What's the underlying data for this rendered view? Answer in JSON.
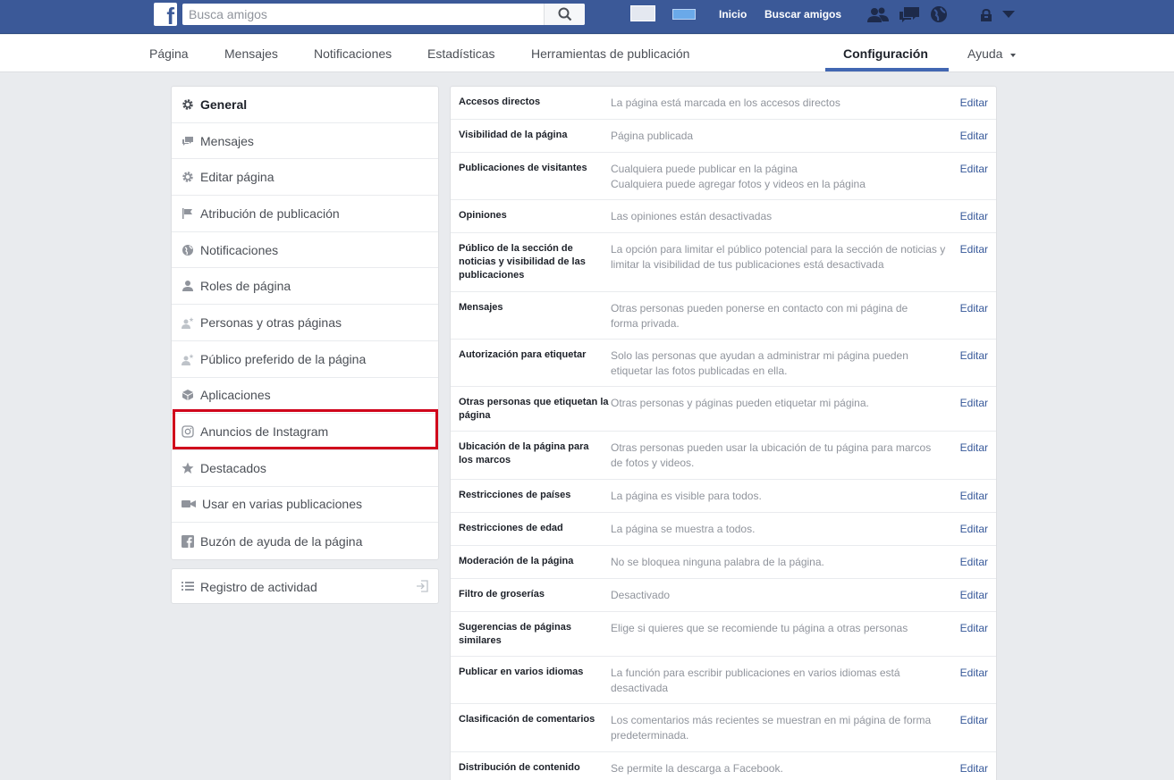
{
  "topbar": {
    "logo": "f",
    "search_placeholder": "Busca amigos",
    "home_label": "Inicio",
    "find_friends_label": "Buscar amigos",
    "icons": [
      "friend-requests-icon",
      "messages-icon",
      "notifications-globe-icon",
      "privacy-lock-icon",
      "account-menu-caret-icon"
    ]
  },
  "pagenav": {
    "items": [
      "Página",
      "Mensajes",
      "Notificaciones",
      "Estadísticas",
      "Herramientas de publicación",
      "Configuración",
      "Ayuda"
    ],
    "active": "Configuración"
  },
  "sidebar": {
    "items": [
      {
        "label": "General",
        "icon": "gear-icon"
      },
      {
        "label": "Mensajes",
        "icon": "messages-icon"
      },
      {
        "label": "Editar página",
        "icon": "gear-icon"
      },
      {
        "label": "Atribución de publicación",
        "icon": "flag-icon"
      },
      {
        "label": "Notificaciones",
        "icon": "globe-icon"
      },
      {
        "label": "Roles de página",
        "icon": "person-icon"
      },
      {
        "label": "Personas y otras páginas",
        "icon": "person-star-icon"
      },
      {
        "label": "Público preferido de la página",
        "icon": "person-star-icon"
      },
      {
        "label": "Aplicaciones",
        "icon": "cube-icon"
      },
      {
        "label": "Anuncios de Instagram",
        "icon": "instagram-icon"
      },
      {
        "label": "Destacados",
        "icon": "star-icon"
      },
      {
        "label": "Usar en varias publicaciones",
        "icon": "video-camera-icon"
      },
      {
        "label": "Buzón de ayuda de la página",
        "icon": "facebook-square-icon"
      }
    ],
    "activity_log": {
      "label": "Registro de actividad",
      "icon": "list-icon",
      "action_icon": "export-icon"
    }
  },
  "settings": {
    "edit_label": "Editar",
    "rows": [
      {
        "label": "Accesos directos",
        "value": "La página está marcada en los accesos directos"
      },
      {
        "label": "Visibilidad de la página",
        "value": "Página publicada"
      },
      {
        "label": "Publicaciones de visitantes",
        "value": "Cualquiera puede publicar en la página\nCualquiera puede agregar fotos y videos en la página"
      },
      {
        "label": "Opiniones",
        "value": "Las opiniones están desactivadas"
      },
      {
        "label": "Público de la sección de noticias y visibilidad de las publicaciones",
        "value": "La opción para limitar el público potencial para la sección de noticias y limitar la visibilidad de tus publicaciones está desactivada"
      },
      {
        "label": "Mensajes",
        "value": "Otras personas pueden ponerse en contacto con mi página de forma privada."
      },
      {
        "label": "Autorización para etiquetar",
        "value": "Solo las personas que ayudan a administrar mi página pueden etiquetar las fotos publicadas en ella."
      },
      {
        "label": "Otras personas que etiquetan la página",
        "value": "Otras personas y páginas pueden etiquetar mi página."
      },
      {
        "label": "Ubicación de la página para los marcos",
        "value": "Otras personas pueden usar la ubicación de tu página para marcos de fotos y videos."
      },
      {
        "label": "Restricciones de países",
        "value": "La página es visible para todos."
      },
      {
        "label": "Restricciones de edad",
        "value": "La página se muestra a todos."
      },
      {
        "label": "Moderación de la página",
        "value": "No se bloquea ninguna palabra de la página."
      },
      {
        "label": "Filtro de groserías",
        "value": "Desactivado"
      },
      {
        "label": "Sugerencias de páginas similares",
        "value": "Elige si quieres que se recomiende tu página a otras personas"
      },
      {
        "label": "Publicar en varios idiomas",
        "value": "La función para escribir publicaciones en varios idiomas está desactivada"
      },
      {
        "label": "Clasificación de comentarios",
        "value": "Los comentarios más recientes se muestran en mi página de forma predeterminada."
      },
      {
        "label": "Distribución de contenido",
        "value": "Se permite la descarga a Facebook."
      }
    ]
  },
  "colors": {
    "brand": "#3b5998",
    "link": "#365899",
    "highlight_border": "#d0021b"
  }
}
